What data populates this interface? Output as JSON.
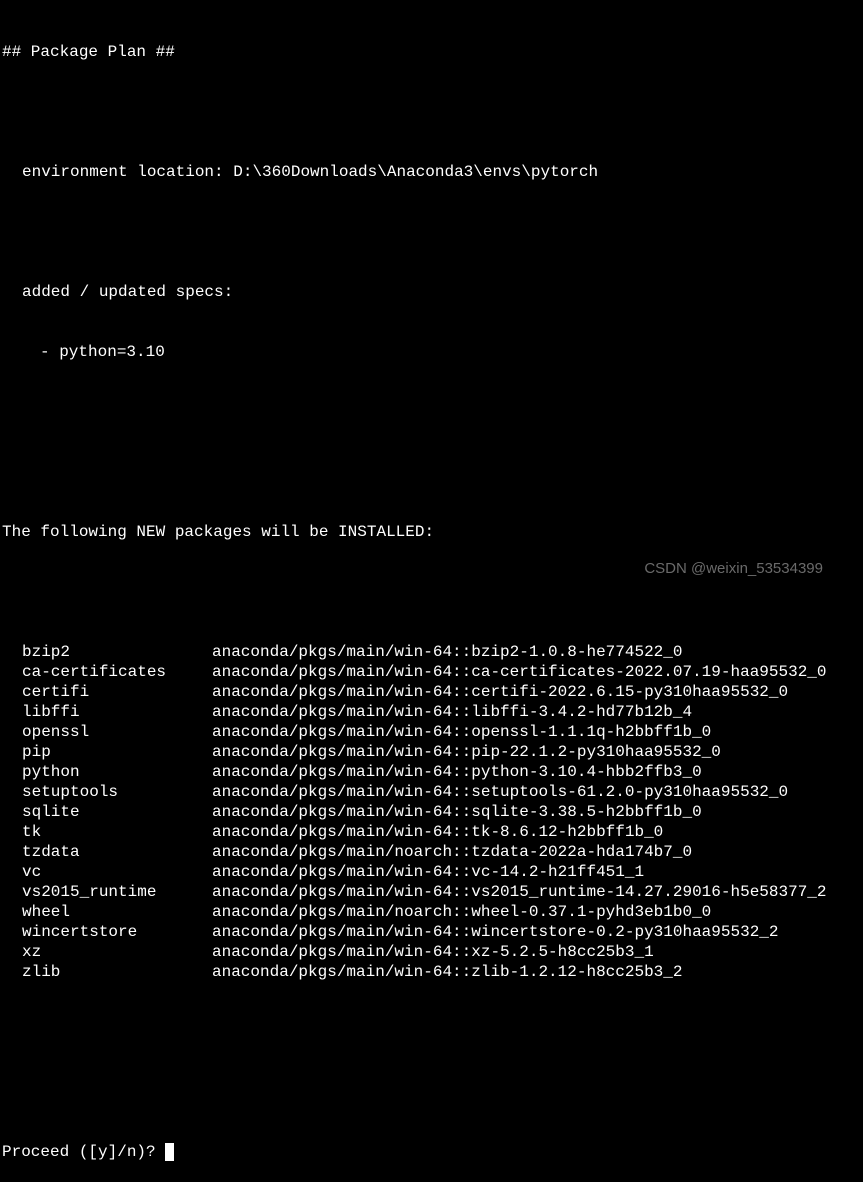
{
  "header": "## Package Plan ##",
  "env_label": "environment location: ",
  "env_path": "D:\\360Downloads\\Anaconda3\\envs\\pytorch",
  "specs_label": "added / updated specs:",
  "specs_item": "- python=3.10",
  "install_header": "The following NEW packages will be INSTALLED:",
  "packages": [
    {
      "name": "bzip2",
      "spec": "anaconda/pkgs/main/win-64::bzip2-1.0.8-he774522_0"
    },
    {
      "name": "ca-certificates",
      "spec": "anaconda/pkgs/main/win-64::ca-certificates-2022.07.19-haa95532_0"
    },
    {
      "name": "certifi",
      "spec": "anaconda/pkgs/main/win-64::certifi-2022.6.15-py310haa95532_0"
    },
    {
      "name": "libffi",
      "spec": "anaconda/pkgs/main/win-64::libffi-3.4.2-hd77b12b_4"
    },
    {
      "name": "openssl",
      "spec": "anaconda/pkgs/main/win-64::openssl-1.1.1q-h2bbff1b_0"
    },
    {
      "name": "pip",
      "spec": "anaconda/pkgs/main/win-64::pip-22.1.2-py310haa95532_0"
    },
    {
      "name": "python",
      "spec": "anaconda/pkgs/main/win-64::python-3.10.4-hbb2ffb3_0"
    },
    {
      "name": "setuptools",
      "spec": "anaconda/pkgs/main/win-64::setuptools-61.2.0-py310haa95532_0"
    },
    {
      "name": "sqlite",
      "spec": "anaconda/pkgs/main/win-64::sqlite-3.38.5-h2bbff1b_0"
    },
    {
      "name": "tk",
      "spec": "anaconda/pkgs/main/win-64::tk-8.6.12-h2bbff1b_0"
    },
    {
      "name": "tzdata",
      "spec": "anaconda/pkgs/main/noarch::tzdata-2022a-hda174b7_0"
    },
    {
      "name": "vc",
      "spec": "anaconda/pkgs/main/win-64::vc-14.2-h21ff451_1"
    },
    {
      "name": "vs2015_runtime",
      "spec": "anaconda/pkgs/main/win-64::vs2015_runtime-14.27.29016-h5e58377_2"
    },
    {
      "name": "wheel",
      "spec": "anaconda/pkgs/main/noarch::wheel-0.37.1-pyhd3eb1b0_0"
    },
    {
      "name": "wincertstore",
      "spec": "anaconda/pkgs/main/win-64::wincertstore-0.2-py310haa95532_2"
    },
    {
      "name": "xz",
      "spec": "anaconda/pkgs/main/win-64::xz-5.2.5-h8cc25b3_1"
    },
    {
      "name": "zlib",
      "spec": "anaconda/pkgs/main/win-64::zlib-1.2.12-h8cc25b3_2"
    }
  ],
  "prompt": "Proceed ([y]/n)? ",
  "watermark": "CSDN @weixin_53534399"
}
